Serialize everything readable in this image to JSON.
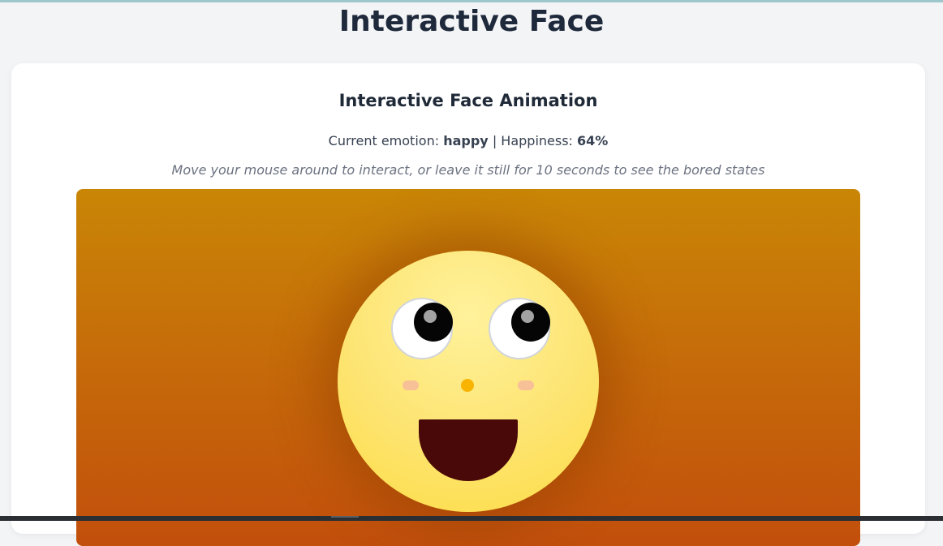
{
  "page": {
    "title": "Interactive Face"
  },
  "card": {
    "title": "Interactive Face Animation",
    "status": {
      "emotion_label": "Current emotion:",
      "emotion_value": "happy",
      "separator": "|",
      "happiness_label": "Happiness:",
      "happiness_value": "64%"
    },
    "hint": "Move your mouse around to interact, or leave it still for 10 seconds to see the bored states"
  },
  "face": {
    "emotion": "happy",
    "happiness": 0.64,
    "colors": {
      "background_top": "#c98606",
      "background_bottom": "#c24f0c",
      "skin": "#fde471",
      "nose": "#f8b400",
      "mouth": "#4a0909",
      "cheek": "#f6b99b"
    }
  }
}
